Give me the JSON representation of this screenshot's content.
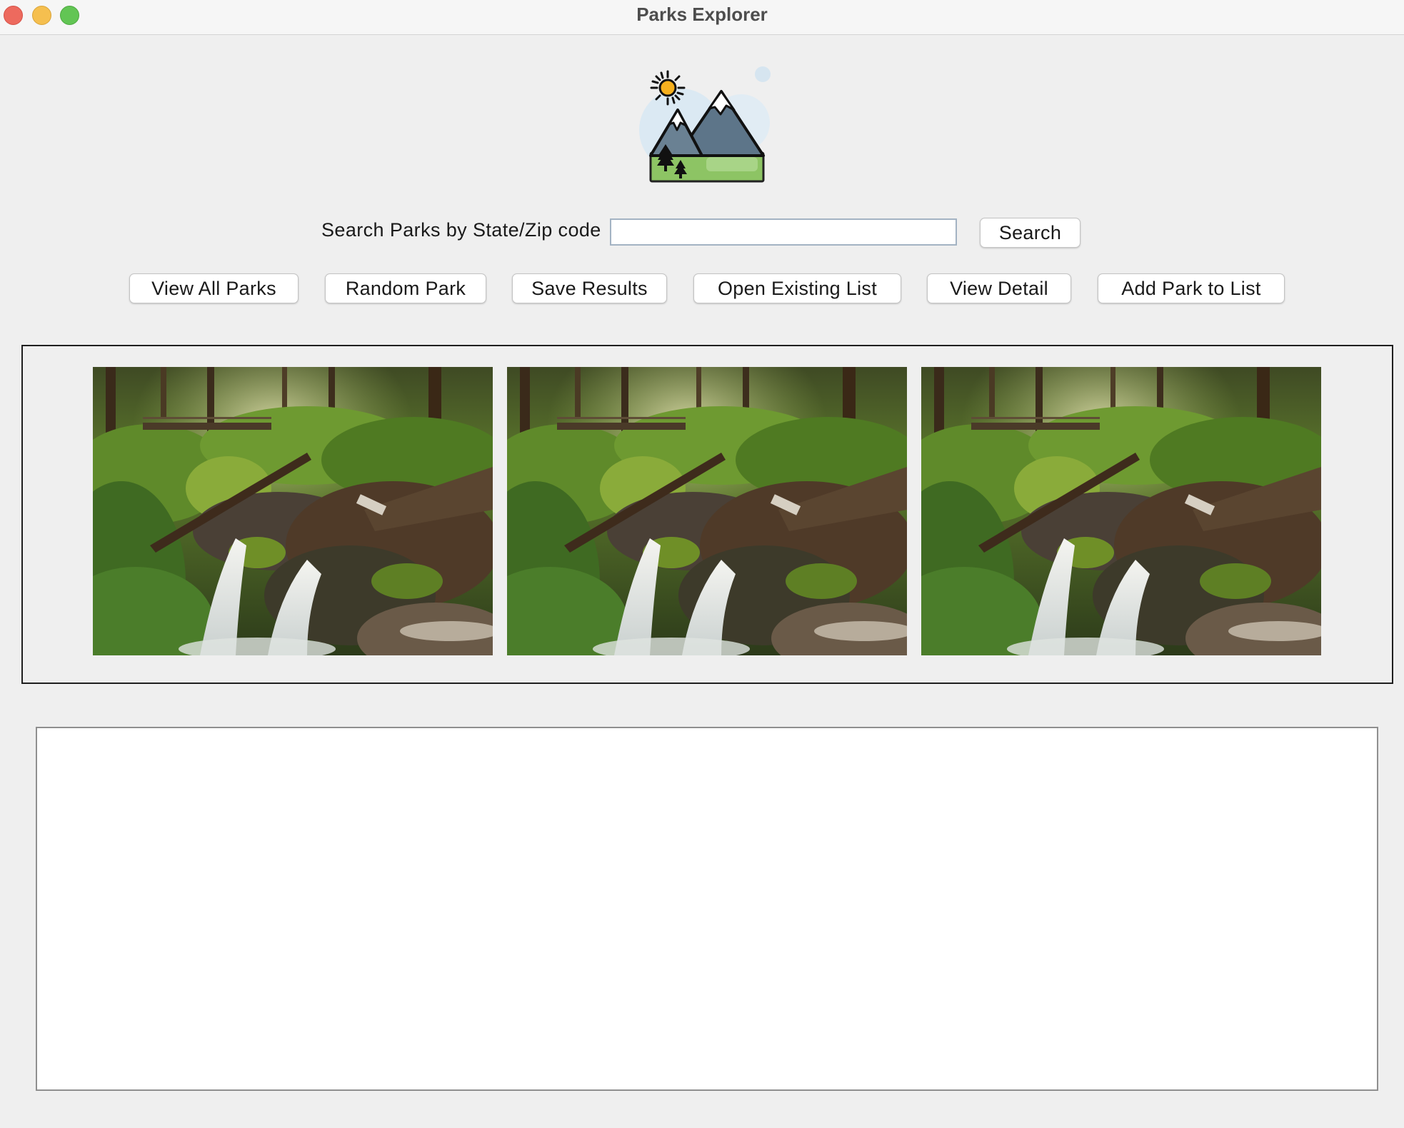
{
  "window": {
    "title": "Parks Explorer"
  },
  "search": {
    "label": "Search Parks by State/Zip code",
    "value": "",
    "placeholder": "",
    "button_label": "Search"
  },
  "toolbar": {
    "view_all_label": "View All Parks",
    "random_label": "Random Park",
    "save_label": "Save Results",
    "open_label": "Open Existing List",
    "detail_label": "View Detail",
    "add_label": "Add Park to List"
  },
  "gallery": {
    "images": [
      {
        "icon": "waterfall-forest-photo"
      },
      {
        "icon": "waterfall-forest-photo"
      },
      {
        "icon": "waterfall-forest-photo"
      }
    ]
  },
  "results": {
    "text": ""
  },
  "icons": {
    "logo": "mountain-sun-logo-icon"
  },
  "colors": {
    "window_bg": "#efefef",
    "button_bg": "#ffffff",
    "input_border": "#a3b3c3",
    "close": "#ed6a5e",
    "minimize": "#f5bf4f",
    "maximize": "#62c554"
  }
}
